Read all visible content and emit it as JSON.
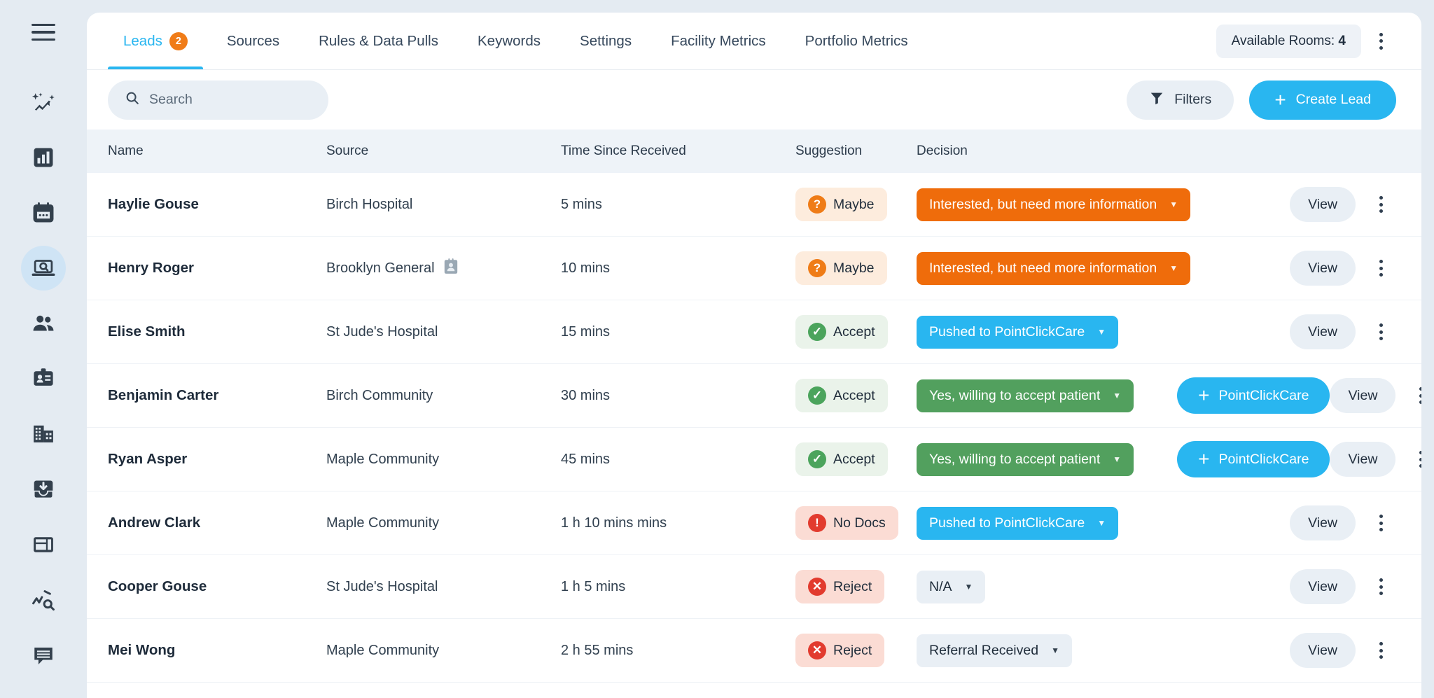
{
  "sidebar": {
    "menu_label": "menu",
    "items": [
      {
        "name": "ai-insights",
        "icon": "sparkle-chart-icon",
        "active": false
      },
      {
        "name": "analytics",
        "icon": "bar-chart-icon",
        "active": false
      },
      {
        "name": "calendar",
        "icon": "calendar-icon",
        "active": false
      },
      {
        "name": "leads",
        "icon": "laptop-search-icon",
        "active": true
      },
      {
        "name": "people",
        "icon": "users-icon",
        "active": false
      },
      {
        "name": "staff-badge",
        "icon": "id-badge-icon",
        "active": false
      },
      {
        "name": "facilities",
        "icon": "building-icon",
        "active": false
      },
      {
        "name": "inbox",
        "icon": "inbox-download-icon",
        "active": false
      },
      {
        "name": "billing",
        "icon": "card-layout-icon",
        "active": false
      },
      {
        "name": "trends",
        "icon": "trend-search-icon",
        "active": false
      },
      {
        "name": "messages",
        "icon": "message-icon",
        "active": false
      }
    ]
  },
  "tabs": [
    {
      "label": "Leads",
      "badge": "2",
      "active": true
    },
    {
      "label": "Sources",
      "badge": "",
      "active": false
    },
    {
      "label": "Rules & Data Pulls",
      "badge": "",
      "active": false
    },
    {
      "label": "Keywords",
      "badge": "",
      "active": false
    },
    {
      "label": "Settings",
      "badge": "",
      "active": false
    },
    {
      "label": "Facility Metrics",
      "badge": "",
      "active": false
    },
    {
      "label": "Portfolio Metrics",
      "badge": "",
      "active": false
    }
  ],
  "header": {
    "available_rooms_label": "Available Rooms:",
    "available_rooms_count": "4"
  },
  "toolbar": {
    "search_placeholder": "Search",
    "search_value": "",
    "filters_label": "Filters",
    "create_label": "Create Lead",
    "plus_glyph": "+"
  },
  "table": {
    "columns": [
      "Name",
      "Source",
      "Time Since Received",
      "Suggestion",
      "Decision"
    ],
    "rows": [
      {
        "name": "Haylie Gouse",
        "source": "Birch Hospital",
        "source_icon": "",
        "time": "5 mins",
        "suggestion": {
          "label": "Maybe",
          "kind": "maybe",
          "glyph": "?"
        },
        "decision": {
          "label": "Interested, but need more information",
          "kind": "orange"
        },
        "secondary_action": "",
        "view_label": "View"
      },
      {
        "name": "Henry Roger",
        "source": "Brooklyn General",
        "source_icon": "contact-card-icon",
        "time": "10 mins",
        "suggestion": {
          "label": "Maybe",
          "kind": "maybe",
          "glyph": "?"
        },
        "decision": {
          "label": "Interested, but need more information",
          "kind": "orange"
        },
        "secondary_action": "",
        "view_label": "View"
      },
      {
        "name": "Elise Smith",
        "source": "St Jude's Hospital",
        "source_icon": "",
        "time": "15 mins",
        "suggestion": {
          "label": "Accept",
          "kind": "accept",
          "glyph": "✓"
        },
        "decision": {
          "label": "Pushed to PointClickCare",
          "kind": "blue"
        },
        "secondary_action": "",
        "view_label": "View"
      },
      {
        "name": "Benjamin Carter",
        "source": "Birch Community",
        "source_icon": "",
        "time": "30 mins",
        "suggestion": {
          "label": "Accept",
          "kind": "accept",
          "glyph": "✓"
        },
        "decision": {
          "label": "Yes, willing to accept patient",
          "kind": "green"
        },
        "secondary_action": "PointClickCare",
        "view_label": "View"
      },
      {
        "name": "Ryan Asper",
        "source": "Maple Community",
        "source_icon": "",
        "time": "45 mins",
        "suggestion": {
          "label": "Accept",
          "kind": "accept",
          "glyph": "✓"
        },
        "decision": {
          "label": "Yes, willing to accept patient",
          "kind": "green"
        },
        "secondary_action": "PointClickCare",
        "view_label": "View"
      },
      {
        "name": "Andrew Clark",
        "source": "Maple Community",
        "source_icon": "",
        "time": "1 h 10 mins mins",
        "suggestion": {
          "label": "No Docs",
          "kind": "nodocs",
          "glyph": "!"
        },
        "decision": {
          "label": "Pushed to PointClickCare",
          "kind": "blue"
        },
        "secondary_action": "",
        "view_label": "View"
      },
      {
        "name": "Cooper Gouse",
        "source": "St Jude's Hospital",
        "source_icon": "",
        "time": "1 h 5 mins",
        "suggestion": {
          "label": "Reject",
          "kind": "reject",
          "glyph": "✕"
        },
        "decision": {
          "label": "N/A",
          "kind": "grey"
        },
        "secondary_action": "",
        "view_label": "View"
      },
      {
        "name": "Mei Wong",
        "source": "Maple Community",
        "source_icon": "",
        "time": "2 h 55 mins",
        "suggestion": {
          "label": "Reject",
          "kind": "reject",
          "glyph": "✕"
        },
        "decision": {
          "label": "Referral Received",
          "kind": "grey"
        },
        "secondary_action": "",
        "view_label": "View"
      }
    ]
  },
  "colors": {
    "accent_blue": "#29b6f0",
    "orange": "#ef6c0b",
    "green": "#52a05e",
    "red": "#e23b2e",
    "page_bg": "#e4ebf2",
    "header_bg": "#eef3f8"
  }
}
